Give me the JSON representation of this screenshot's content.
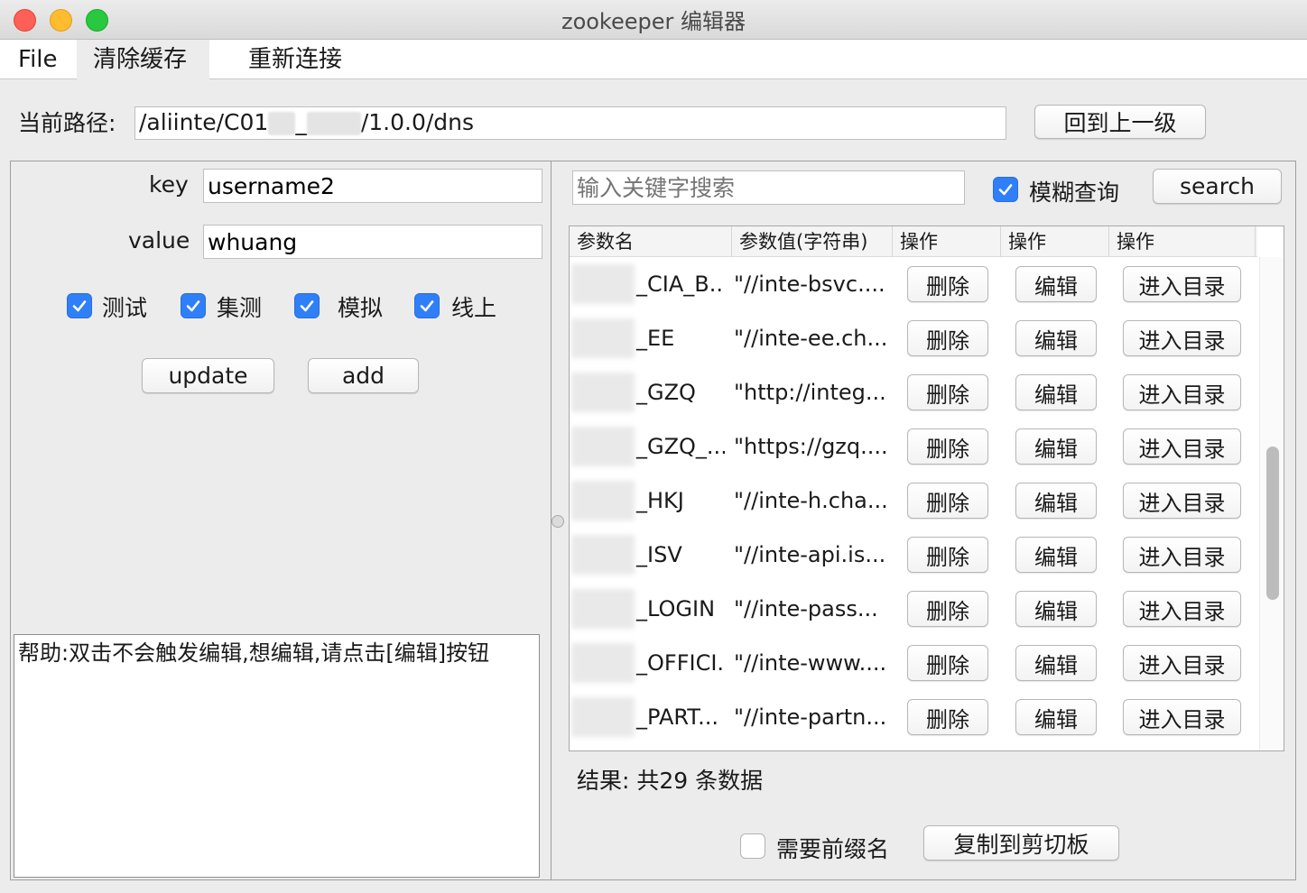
{
  "window": {
    "title": "zookeeper 编辑器"
  },
  "menu": {
    "items": [
      "File",
      "清除缓存",
      "重新连接"
    ]
  },
  "path": {
    "label": "当前路径:",
    "prefix": "/aliinte/C01",
    "mid": "_",
    "suffix": "/1.0.0/dns",
    "back_button": "回到上一级"
  },
  "form": {
    "key_label": "key",
    "key_value": "username2",
    "value_label": "value",
    "value_value": "whuang",
    "envs": [
      {
        "label": "测试",
        "checked": true
      },
      {
        "label": "集测",
        "checked": true
      },
      {
        "label": "模拟",
        "checked": true
      },
      {
        "label": "线上",
        "checked": true
      }
    ],
    "update_button": "update",
    "add_button": "add"
  },
  "search": {
    "placeholder": "输入关键字搜索",
    "fuzzy_label": "模糊查询",
    "fuzzy_checked": true,
    "button": "search"
  },
  "table": {
    "headers": [
      "参数名",
      "参数值(字符串)",
      "操作",
      "操作",
      "操作"
    ],
    "actions": {
      "delete": "删除",
      "edit": "编辑",
      "enter": "进入目录"
    },
    "rows": [
      {
        "name": "_CIA_B...",
        "value": "\"//inte-bsvc...."
      },
      {
        "name": "_EE",
        "value": "\"//inte-ee.ch..."
      },
      {
        "name": "_GZQ",
        "value": "\"http://integ..."
      },
      {
        "name": "_GZQ_...",
        "value": "\"https://gzq...."
      },
      {
        "name": "_HKJ",
        "value": "\"//inte-h.cha..."
      },
      {
        "name": "_ISV",
        "value": "\"//inte-api.is..."
      },
      {
        "name": "_LOGIN",
        "value": "\"//inte-pass..."
      },
      {
        "name": "_OFFICI...",
        "value": "\"//inte-www...."
      },
      {
        "name": "_PART...",
        "value": "\"//inte-partn..."
      }
    ]
  },
  "result": {
    "text": "结果: 共29 条数据"
  },
  "footer": {
    "prefix_label": "需要前缀名",
    "prefix_checked": false,
    "copy_button": "复制到剪切板"
  },
  "help": {
    "text": "帮助:双击不会触发编辑,想编辑,请点击[编辑]按钮"
  },
  "colors": {
    "accent": "#2f7ff8",
    "window_bg": "#ececec"
  }
}
